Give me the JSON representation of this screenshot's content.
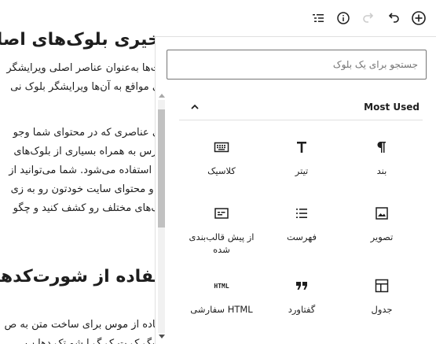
{
  "editor_background": {
    "heading_1": "خیری بلوک‌های اصلی",
    "lines_1": [
      "ت‌ها به‌عنوان عناصر اصلی ویرایشگر",
      "ی مواقع به آن‌ها ویرایشگر بلوک نی"
    ],
    "lines_2": [
      "ی عناصری که در محتوای شما وجو",
      "پرس به همراه بسیاری از بلوک‌های",
      "ه استفاده می‌شود. شما می‌توانید از",
      "، و محتوای سایت خودتون رو به زی",
      "ک‌های مختلف رو کشف کنید و چگو"
    ],
    "heading_2": "تفاده از شورت‌کدهای",
    "lines_3": [
      "فاده از موس برای ساخت متن به ص",
      "شگ ک ت ک گ ا شو تک دها ب"
    ]
  },
  "toolbar": {
    "buttons": [
      {
        "name": "list-view-icon"
      },
      {
        "name": "info-icon"
      },
      {
        "name": "redo-icon"
      },
      {
        "name": "undo-icon"
      },
      {
        "name": "add-block-icon"
      }
    ]
  },
  "inserter": {
    "search_placeholder": "جستجو برای یک بلوک",
    "section_title": "Most Used",
    "blocks": [
      {
        "label": "بند",
        "icon": "paragraph-icon"
      },
      {
        "label": "تیتر",
        "icon": "heading-icon"
      },
      {
        "label": "کلاسیک",
        "icon": "classic-keyboard-icon"
      },
      {
        "label": "تصویر",
        "icon": "image-icon"
      },
      {
        "label": "فهرست",
        "icon": "list-icon"
      },
      {
        "label": "از پیش قالب‌بندی شده",
        "icon": "preformatted-icon"
      },
      {
        "label": "جدول",
        "icon": "table-icon"
      },
      {
        "label": "گفتاورد",
        "icon": "quote-icon"
      },
      {
        "label": "HTML سفارشی",
        "icon": "html-icon"
      }
    ],
    "html_icon_text": "HTML"
  },
  "colors": {
    "icon": "#1e1e1e",
    "disabled_icon": "#cccccc",
    "border": "#757575"
  }
}
